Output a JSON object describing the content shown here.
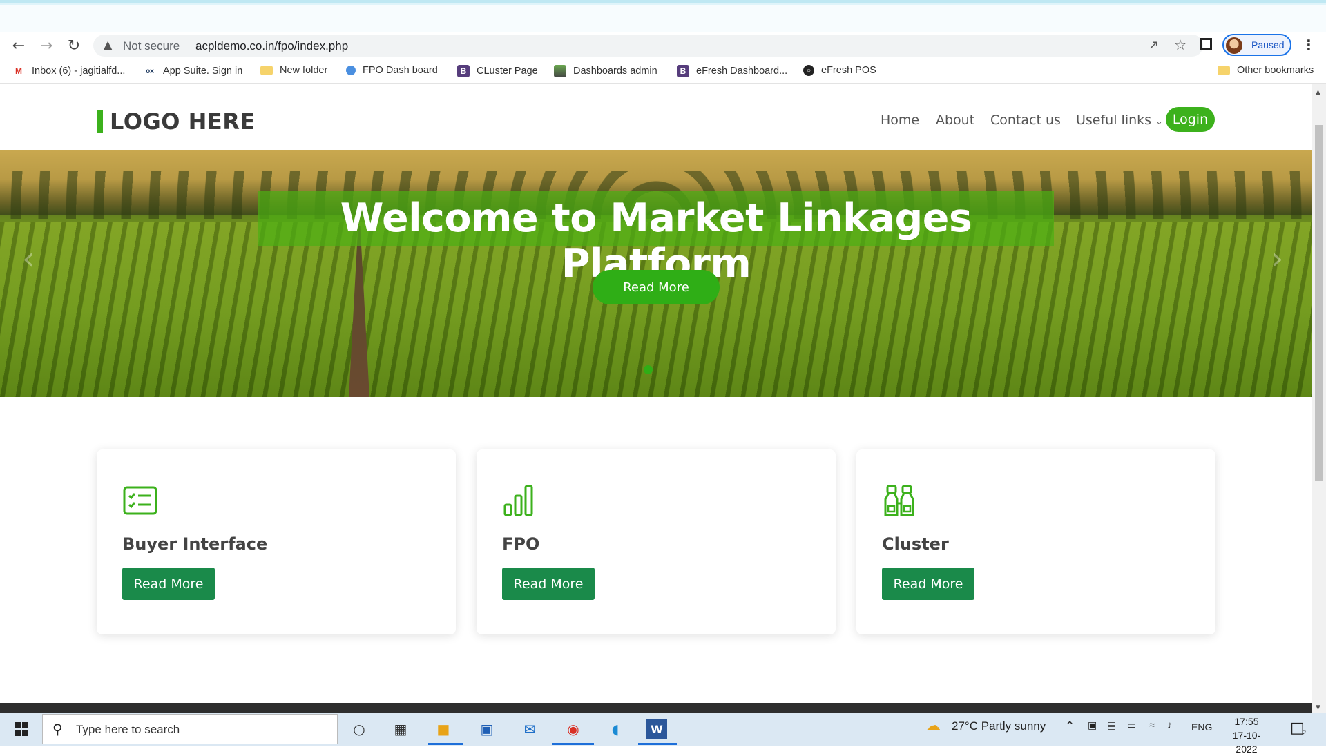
{
  "browser": {
    "not_secure": "Not secure",
    "url": "acpldemo.co.in/fpo/index.php",
    "profile_status": "Paused",
    "bookmarks": [
      {
        "label": "Inbox (6) - jagitialfd...",
        "icon": "gmail-icon"
      },
      {
        "label": "App Suite. Sign in",
        "icon": "ox-icon"
      },
      {
        "label": "New folder",
        "icon": "folder-icon"
      },
      {
        "label": "FPO Dash board",
        "icon": "site-icon"
      },
      {
        "label": "CLuster Page",
        "icon": "bootstrap-icon"
      },
      {
        "label": "Dashboards admin",
        "icon": "image-icon"
      },
      {
        "label": "eFresh Dashboard...",
        "icon": "bootstrap-icon"
      },
      {
        "label": "eFresh POS",
        "icon": "globe-icon"
      }
    ],
    "other_bookmarks": "Other bookmarks"
  },
  "site": {
    "logo": "LOGO HERE",
    "nav": {
      "home": "Home",
      "about": "About",
      "contact": "Contact us",
      "useful_links": "Useful links",
      "login": "Login"
    },
    "hero": {
      "title": "Welcome to Market Linkages Platform",
      "button": "Read More"
    },
    "cards": [
      {
        "title": "Buyer Interface",
        "button": "Read More",
        "icon": "checklist-icon"
      },
      {
        "title": "FPO",
        "button": "Read More",
        "icon": "bar-chart-icon"
      },
      {
        "title": "Cluster",
        "button": "Read More",
        "icon": "binoculars-icon"
      }
    ],
    "accent_color": "#3cb11c",
    "button_color": "#1a8a4a"
  },
  "taskbar": {
    "search_placeholder": "Type here to search",
    "weather": "27°C  Partly sunny",
    "language": "ENG",
    "time": "17:55",
    "date": "17-10-2022",
    "notifications": "2"
  }
}
